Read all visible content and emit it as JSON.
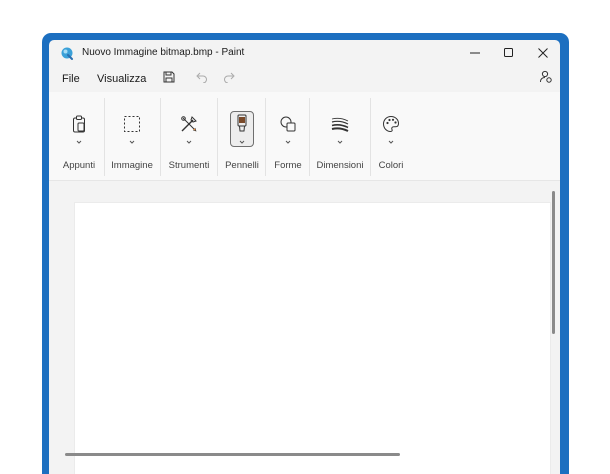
{
  "window": {
    "title": "Nuovo Immagine bitmap.bmp - Paint",
    "frame_color": "#1c6fc0"
  },
  "titlebar_buttons": [
    "minimize-icon",
    "maximize-icon",
    "close-icon"
  ],
  "menu": {
    "file": "File",
    "view": "Visualizza"
  },
  "quick_access": [
    "save-icon",
    "undo-icon",
    "redo-icon"
  ],
  "account_icon": "account-icon",
  "ribbon": {
    "groups": [
      {
        "label": "Appunti",
        "icon": "clipboard-icon"
      },
      {
        "label": "Immagine",
        "icon": "selection-icon"
      },
      {
        "label": "Strumenti",
        "icon": "tools-icon"
      },
      {
        "label": "Pennelli",
        "icon": "brush-icon"
      },
      {
        "label": "Forme",
        "icon": "shapes-icon"
      },
      {
        "label": "Dimensioni",
        "icon": "size-icon"
      },
      {
        "label": "Colori",
        "icon": "palette-icon"
      }
    ]
  }
}
